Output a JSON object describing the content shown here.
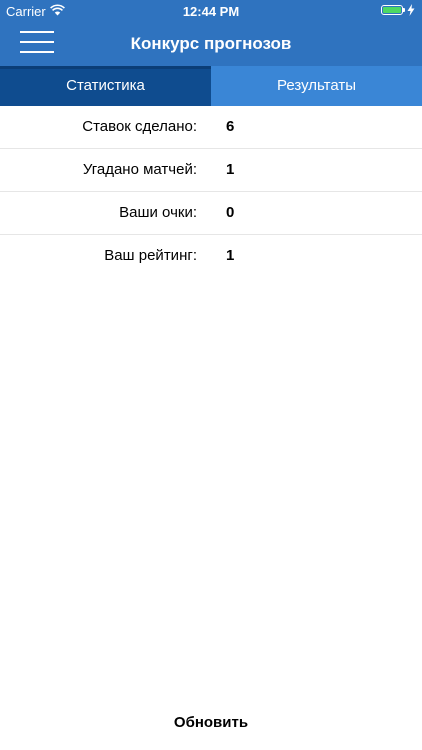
{
  "status_bar": {
    "carrier": "Carrier",
    "time": "12:44 PM",
    "wifi_icon": "wifi-icon",
    "battery_icon": "battery-icon",
    "charging_icon": "bolt-icon",
    "battery_level": 1.0,
    "battery_color": "#4cd964"
  },
  "header": {
    "title": "Конкурс прогнозов",
    "menu_icon": "hamburger-menu-icon",
    "background": "#2f73bf"
  },
  "tabs": [
    {
      "label": "Статистика",
      "active": true,
      "color": "#0f4c8f"
    },
    {
      "label": "Результаты",
      "active": false,
      "color": "#3a86d6"
    }
  ],
  "stats": [
    {
      "label": "Ставок сделано:",
      "value": "6"
    },
    {
      "label": "Угадано матчей:",
      "value": "1"
    },
    {
      "label": "Ваши очки:",
      "value": "0"
    },
    {
      "label": "Ваш рейтинг:",
      "value": "1"
    }
  ],
  "footer": {
    "refresh_label": "Обновить"
  }
}
